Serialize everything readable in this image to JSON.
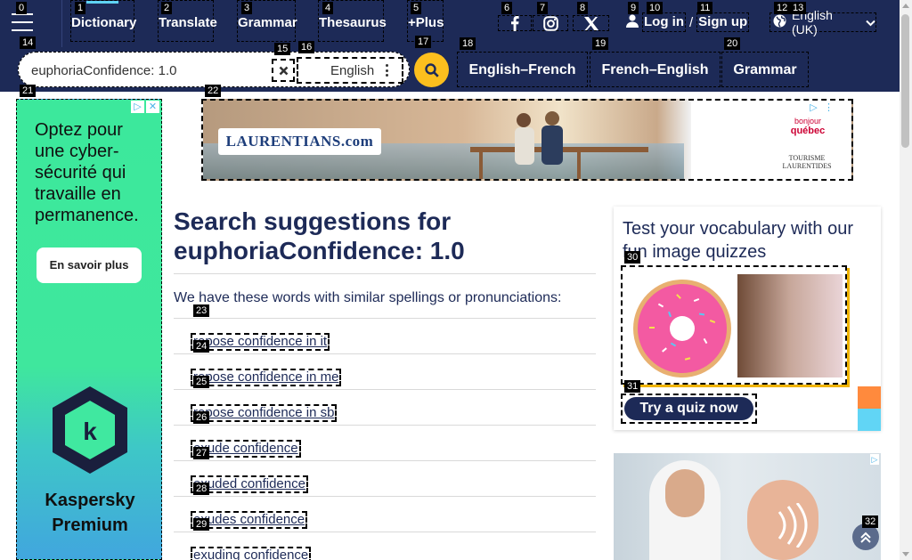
{
  "nav": {
    "links": [
      "Dictionary",
      "Translate",
      "Grammar",
      "Thesaurus",
      "+Plus"
    ],
    "social": [
      "facebook-icon",
      "instagram-icon",
      "x-icon"
    ],
    "login": "Log in",
    "separator": "/",
    "signup": "Sign up",
    "language": "English (UK)"
  },
  "search": {
    "query": "euphoriaConfidence: 1.0",
    "dictionary": "English",
    "quick_links": [
      "English–French",
      "French–English",
      "Grammar"
    ]
  },
  "badges": [
    "0",
    "1",
    "2",
    "3",
    "4",
    "5",
    "6",
    "7",
    "8",
    "9",
    "10",
    "11",
    "12",
    "13",
    "14",
    "15",
    "16",
    "17",
    "18",
    "19",
    "20",
    "21",
    "22",
    "23",
    "24",
    "25",
    "26",
    "27",
    "28",
    "29",
    "30",
    "31",
    "32"
  ],
  "left_ad": {
    "headline": "Optez pour une cyber-sécurité qui travaille en permanence.",
    "cta": "En savoir plus",
    "brand_line1": "Kaspersky",
    "brand_line2": "Premium",
    "logo_letter": "k"
  },
  "banner_ad": {
    "brand": "LAURENTIANS.com",
    "partner1_line1": "bonjour",
    "partner1_line2": "québec",
    "partner2_line1": "TOURISME",
    "partner2_line2": "LAURENTIDES"
  },
  "main": {
    "title_prefix": "Search suggestions for",
    "title_query": "euphoriaConfidence: 1.0",
    "intro": "We have these words with similar spellings or pronunciations:",
    "suggestions": [
      "repose confidence in it",
      "repose confidence in me",
      "repose confidence in sb",
      "exude confidence",
      "exuded confidence",
      "exudes confidence",
      "exuding confidence"
    ]
  },
  "quiz": {
    "title": "Test your vocabulary with our fun image quizzes",
    "button": "Try a quiz now"
  },
  "colors": {
    "navy": "#1d2a57",
    "accent_yellow": "#fcbf1e",
    "active_underline": "#5fd3f3",
    "side_tab_orange": "#ff8a3d",
    "side_tab_blue": "#61d5f5"
  }
}
